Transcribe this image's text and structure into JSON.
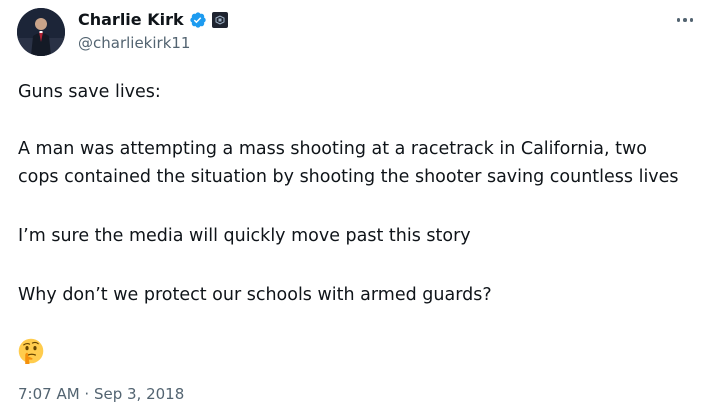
{
  "author": {
    "display_name": "Charlie Kirk",
    "handle": "@charliekirk11",
    "verified_badge_color": "#1d9bf0",
    "org_badge_color": "#1f2430"
  },
  "tweet": {
    "paragraphs": [
      "Guns save lives:",
      "A man was attempting a mass shooting at a racetrack in California, two",
      "cops contained the situation by shooting the shooter saving countless lives",
      "I’m sure the media will quickly move past this story",
      "Why don’t we protect our schools with armed guards?"
    ],
    "emoji": "thinking-face-emoji",
    "timestamp": "7:07 AM · Sep 3, 2018"
  },
  "icons": {
    "more": "more-options-icon",
    "verified": "verified-badge-icon",
    "org": "organization-badge-icon"
  }
}
